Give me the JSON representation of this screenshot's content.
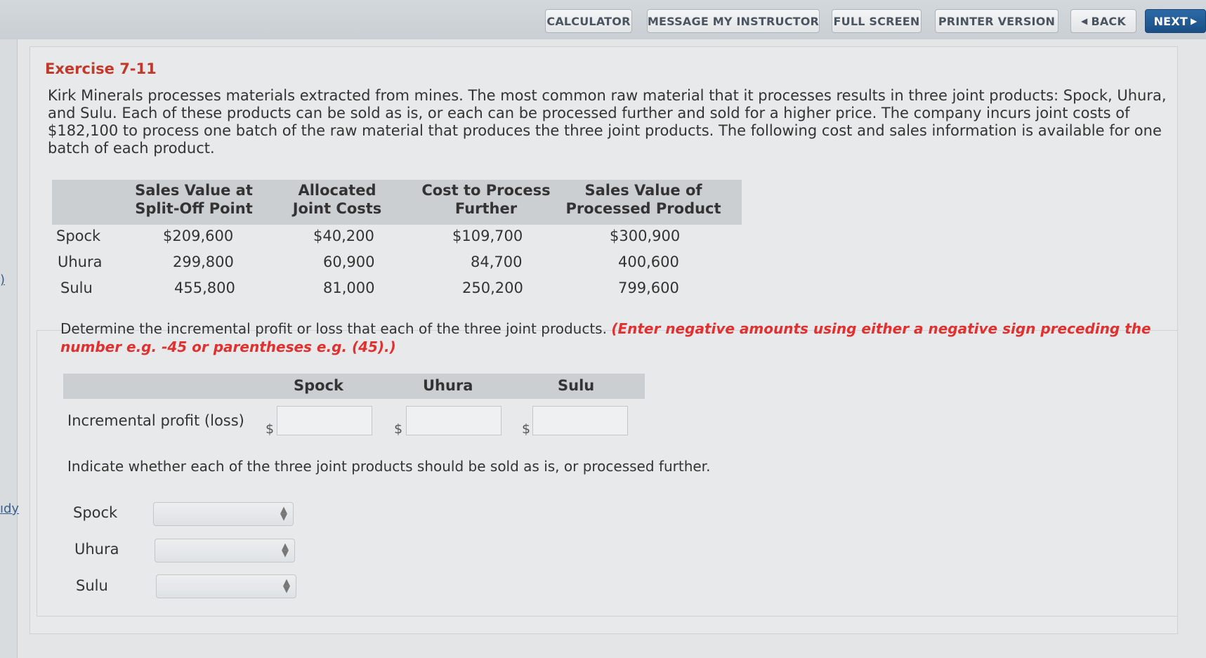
{
  "toolbar": {
    "calculator": "CALCULATOR",
    "message": "MESSAGE MY INSTRUCTOR",
    "full_screen": "FULL SCREEN",
    "printer": "PRINTER VERSION",
    "back": "BACK",
    "next": "NEXT",
    "back_icon": "chevron-left-icon",
    "next_icon": "triangle-right-icon"
  },
  "side": {
    "link_a": ")",
    "link_b": "ıdy"
  },
  "exercise": {
    "title": "Exercise 7-11",
    "problem": "Kirk Minerals processes materials extracted from mines. The most common raw material that it processes results in three joint products: Spock, Uhura, and Sulu. Each of these products can be sold as is, or each can be processed further and sold for a higher price. The company incurs joint costs of $182,100 to process one batch of the raw material that produces the three joint products. The following cost and sales information is available for one batch of each product."
  },
  "table": {
    "headers": [
      [
        "Sales Value at",
        "Split-Off Point"
      ],
      [
        "Allocated",
        "Joint Costs"
      ],
      [
        "Cost to Process",
        "Further"
      ],
      [
        "Sales Value of",
        "Processed Product"
      ]
    ],
    "rows": [
      {
        "name": "Spock",
        "values": [
          "$209,600",
          "$40,200",
          "$109,700",
          "$300,900"
        ]
      },
      {
        "name": "Uhura",
        "values": [
          "299,800",
          "60,900",
          "84,700",
          "400,600"
        ]
      },
      {
        "name": "Sulu",
        "values": [
          "455,800",
          "81,000",
          "250,200",
          "799,600"
        ]
      }
    ]
  },
  "question": {
    "text": "Determine the incremental profit or loss that each of the three joint products. ",
    "instruction": "(Enter negative amounts using either a negative sign preceding the number e.g. -45 or parentheses e.g. (45).)"
  },
  "answer": {
    "headers": [
      "Spock",
      "Uhura",
      "Sulu"
    ],
    "row_label": "Incremental profit (loss)",
    "currency": "$"
  },
  "decision": {
    "prompt": "Indicate whether each of the three joint products should be sold as is, or processed further.",
    "rows": [
      "Spock",
      "Uhura",
      "Sulu"
    ],
    "select_icon": "select-arrows-icon"
  }
}
